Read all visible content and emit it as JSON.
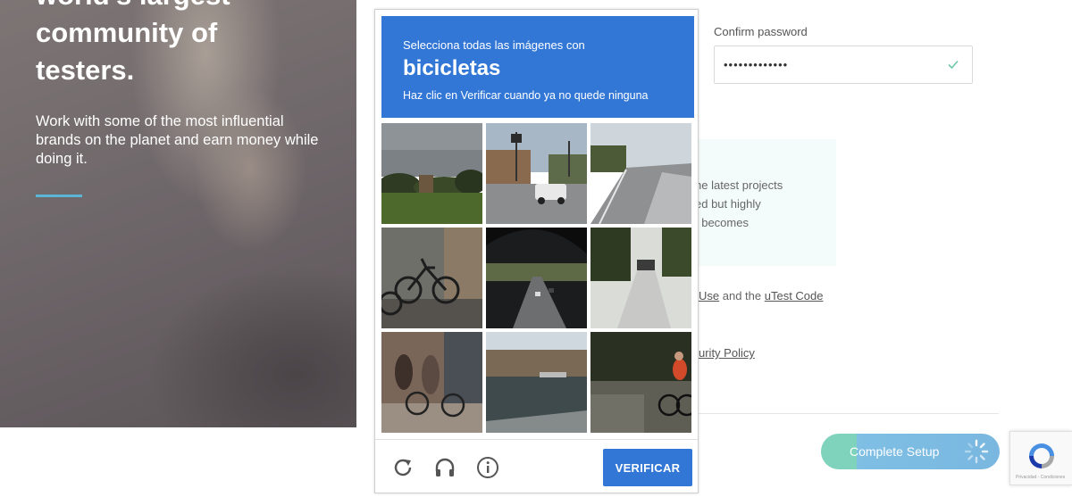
{
  "hero": {
    "title_line1": "world's largest",
    "title_line2": "community of",
    "title_line3": "testers.",
    "subtitle": "Work with some of the most influential brands on the planet and earn money while doing it.",
    "accent_color": "#5bb6d6"
  },
  "form": {
    "confirm_password_label": "Confirm password",
    "confirm_password_value": "•••••••••••••",
    "info_lines": [
      "he latest projects",
      "ed but highly",
      "t becomes"
    ],
    "terms_link1": "Use",
    "terms_middle": " and the ",
    "terms_link2": "uTest Code",
    "policy_link": "urity Policy",
    "complete_button": "Complete Setup"
  },
  "captcha": {
    "instruction": "Selecciona todas las imágenes con",
    "target_word": "bicicletas",
    "hint": "Haz clic en Verificar cuando ya no quede ninguna",
    "verify_button": "VERIFICAR",
    "header_color": "#3377d6",
    "icons": [
      "reload-icon",
      "audio-icon",
      "info-icon"
    ],
    "tiles": [
      "grass-trees-cloudy",
      "street-intersection-truck",
      "empty-road",
      "parked-bicycles",
      "highway-traffic",
      "street-with-car",
      "people-bicycles-sidewalk",
      "lake-shore",
      "cyclist-road"
    ]
  },
  "recaptcha_badge": {
    "small_text": "Privacidad - Condiciones"
  }
}
